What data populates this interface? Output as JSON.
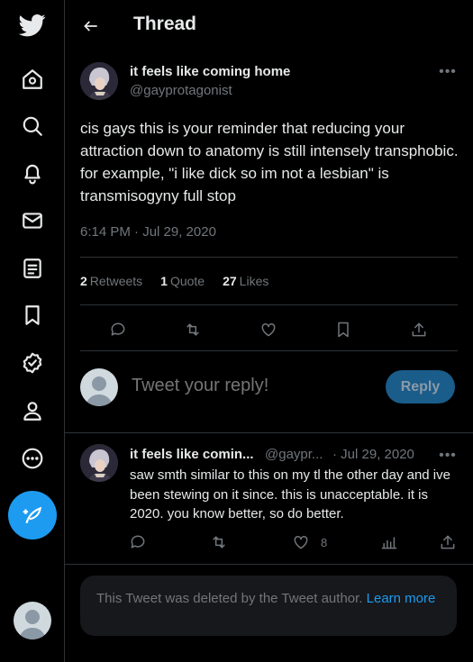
{
  "header": {
    "title": "Thread"
  },
  "sidebar": {
    "items": [
      {
        "icon": "twitter-logo-icon"
      },
      {
        "icon": "home-icon"
      },
      {
        "icon": "search-icon"
      },
      {
        "icon": "notifications-icon"
      },
      {
        "icon": "messages-icon"
      },
      {
        "icon": "lists-icon"
      },
      {
        "icon": "bookmarks-icon"
      },
      {
        "icon": "verified-icon"
      },
      {
        "icon": "profile-icon"
      },
      {
        "icon": "more-icon"
      }
    ],
    "compose_icon": "compose-tweet-icon"
  },
  "tweet": {
    "author_name": "it feels like coming home",
    "author_handle": "@gayprotagonist",
    "text": "cis gays this is your reminder that reducing your attraction down to anatomy is still intensely transphobic. for example, \"i like dick so im not a lesbian\" is transmisogyny full stop",
    "timestamp": "6:14 PM · Jul 29, 2020",
    "stats": {
      "retweets_count": "2",
      "retweets_label": "Retweets",
      "quotes_count": "1",
      "quotes_label": "Quote",
      "likes_count": "27",
      "likes_label": "Likes"
    }
  },
  "reply_box": {
    "placeholder": "Tweet your reply!",
    "button_label": "Reply"
  },
  "reply": {
    "author_name": "it feels like comin...",
    "author_handle": "@gaypr...",
    "date": "· Jul 29, 2020",
    "text": "saw smth similar to this on my tl the other day and ive been stewing on it since. this is unacceptable. it is 2020. you know better, so do better.",
    "like_count": "8"
  },
  "deleted_notice": {
    "text": "This Tweet was deleted by the Tweet author.",
    "link": "Learn more"
  },
  "colors": {
    "accent": "#1d9bf0",
    "background": "#000000",
    "muted": "#71767b"
  }
}
